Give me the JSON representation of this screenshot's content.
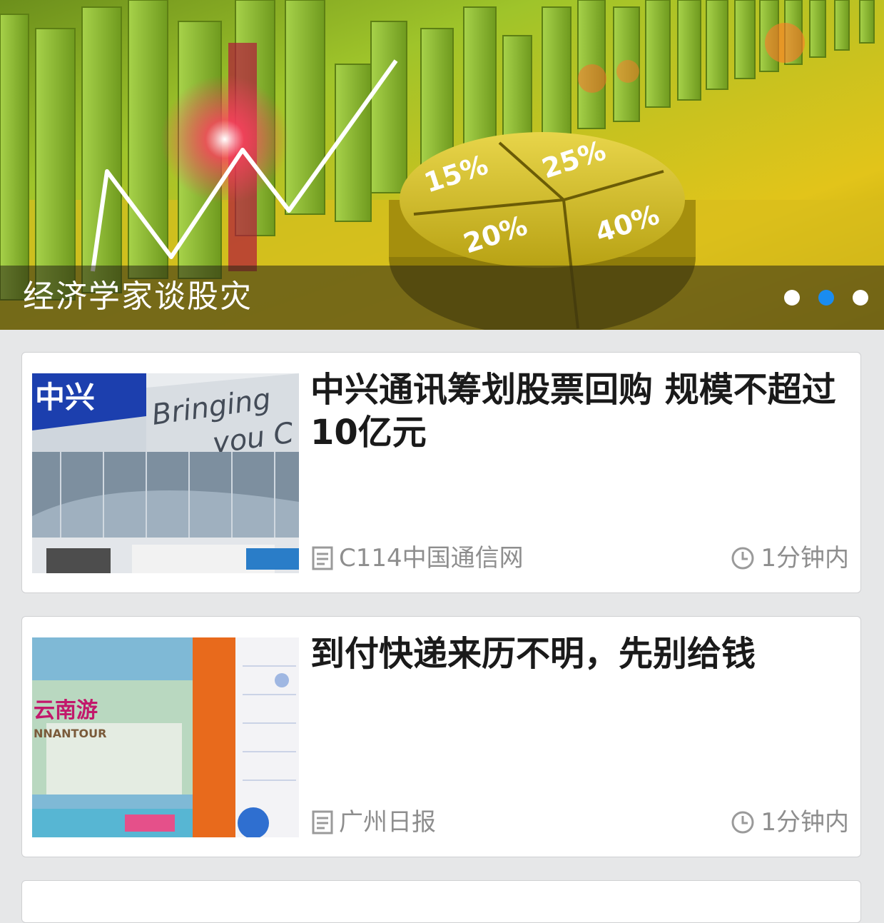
{
  "banner": {
    "caption": "经济学家谈股灾",
    "slide_count": 3,
    "active_index": 1,
    "art_labels": [
      "15%",
      "25%",
      "20%",
      "40%"
    ]
  },
  "articles": [
    {
      "title": "中兴通讯筹划股票回购 规模不超过10亿元",
      "source": "C114中国通信网",
      "time": "1分钟内",
      "thumb_text": [
        "中兴",
        "Bringing",
        "you C"
      ]
    },
    {
      "title": "到付快递来历不明，先别给钱",
      "source": "广州日报",
      "time": "1分钟内",
      "thumb_text": [
        "云南游",
        "NNANTOUR"
      ]
    }
  ],
  "colors": {
    "accent": "#1a8cf0",
    "meta_text": "#8e8e8e",
    "headline": "#1a1a1a",
    "background": "#e6e7e8"
  },
  "icons": {
    "source": "newspaper-icon",
    "time": "clock-icon"
  }
}
